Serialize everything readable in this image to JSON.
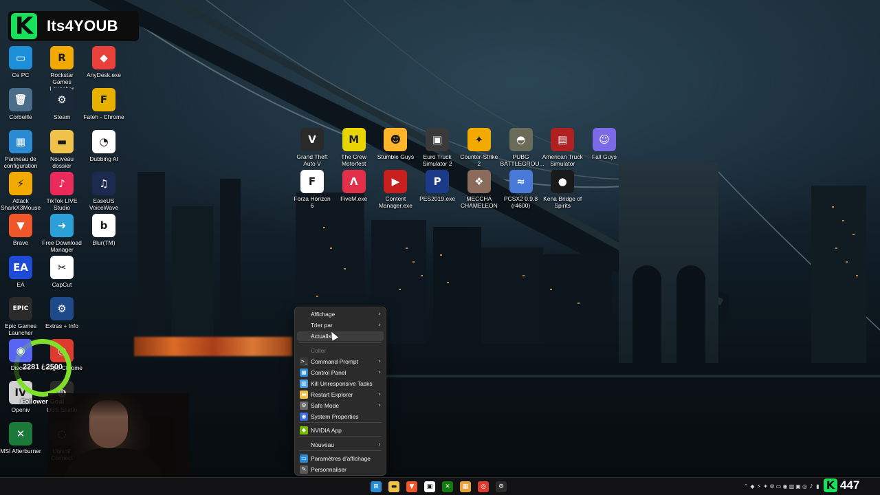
{
  "branding": {
    "logo_letter": "K",
    "channel_name": "Its4YOUB"
  },
  "desktop_icons_left": [
    {
      "label": "Ce PC",
      "glyph": "▭",
      "color": "#1d8fd8"
    },
    {
      "label": "Rockstar Games Launcher",
      "glyph": "R",
      "color": "#f2a900"
    },
    {
      "label": "AnyDesk.exe",
      "glyph": "◆",
      "color": "#e8403b"
    },
    {
      "label": "Corbeille",
      "glyph": "🗑",
      "color": "#4a6e8a"
    },
    {
      "label": "Steam",
      "glyph": "⚙",
      "color": "#1b2838"
    },
    {
      "label": "Fateh - Chrome",
      "glyph": "F",
      "color": "#e8b100"
    },
    {
      "label": "Panneau de configuration",
      "glyph": "▦",
      "color": "#2a8ad4"
    },
    {
      "label": "Nouveau dossier",
      "glyph": "▬",
      "color": "#f0c24a"
    },
    {
      "label": "Dubbing AI",
      "glyph": "◔",
      "color": "#ffffff"
    },
    {
      "label": "Attack SharkX3Mouse",
      "glyph": "⚡",
      "color": "#f2a900"
    },
    {
      "label": "TikTok LIVE Studio",
      "glyph": "♪",
      "color": "#ea2a5a"
    },
    {
      "label": "EaseUS VoiceWave",
      "glyph": "♫",
      "color": "#1b2a4e"
    },
    {
      "label": "Brave",
      "glyph": "▼",
      "color": "#f1562b"
    },
    {
      "label": "Free Download Manager",
      "glyph": "➜",
      "color": "#2a9fd8"
    },
    {
      "label": "Blur(TM)",
      "glyph": "b",
      "color": "#ffffff"
    },
    {
      "label": "EA",
      "glyph": "EA",
      "color": "#1e4ad8"
    },
    {
      "label": "CapCut",
      "glyph": "✂",
      "color": "#ffffff"
    },
    {
      "label": "Epic Games Launcher",
      "glyph": "EPIC",
      "color": "#2b2b2b"
    },
    {
      "label": "Extras + Info",
      "glyph": "⚙",
      "color": "#1f4a8a"
    },
    {
      "label": "Discord",
      "glyph": "◉",
      "color": "#5865f2"
    },
    {
      "label": "Google Chrome",
      "glyph": "◎",
      "color": "#dd3b2d"
    },
    {
      "label": "Openiv",
      "glyph": "IV",
      "color": "#cfcfcf"
    },
    {
      "label": "OBS Studio",
      "glyph": "◍",
      "color": "#2b2b2b"
    },
    {
      "label": "MSI Afterburner",
      "glyph": "✕",
      "color": "#1b7a3a"
    },
    {
      "label": "Ubisoft Connect",
      "glyph": "◌",
      "color": "#1b1b1b"
    }
  ],
  "desktop_icons_games": [
    {
      "label": "Grand Theft Auto V",
      "glyph": "V",
      "color": "#2a2a2a"
    },
    {
      "label": "The Crew Motorfest",
      "glyph": "M",
      "color": "#e8d400"
    },
    {
      "label": "Stumble Guys",
      "glyph": "☻",
      "color": "#ffb52a"
    },
    {
      "label": "Euro Truck Simulator 2",
      "glyph": "▣",
      "color": "#3a3a3a"
    },
    {
      "label": "Counter-Strike 2",
      "glyph": "✦",
      "color": "#f2a900"
    },
    {
      "label": "PUBG BATTLEGROU...",
      "glyph": "◓",
      "color": "#6b6b5a"
    },
    {
      "label": "American Truck Simulator",
      "glyph": "▤",
      "color": "#b02020"
    },
    {
      "label": "Fall Guys",
      "glyph": "☺",
      "color": "#7a6ae8"
    },
    {
      "label": "Forza Horizon 6",
      "glyph": "F",
      "color": "#ffffff"
    },
    {
      "label": "FiveM.exe",
      "glyph": "Λ",
      "color": "#e3304a"
    },
    {
      "label": "Content Manager.exe",
      "glyph": "▶",
      "color": "#c81f1f"
    },
    {
      "label": "PES2019.exe",
      "glyph": "P",
      "color": "#1b3a8a"
    },
    {
      "label": "MECCHA CHAMELEON",
      "glyph": "❖",
      "color": "#8a6a5a"
    },
    {
      "label": "PCSX2 0.9.8 (r4600)",
      "glyph": "≈",
      "color": "#4a7ad8"
    },
    {
      "label": "Kena Bridge of Spirits",
      "glyph": "●",
      "color": "#1a1a1a"
    }
  ],
  "context_menu": {
    "items": [
      {
        "label": "Affichage",
        "icon": "",
        "chevron": true
      },
      {
        "label": "Trier par",
        "icon": "",
        "chevron": true
      },
      {
        "label": "Actualiser",
        "icon": "",
        "chevron": false
      },
      {
        "label": "Coller",
        "icon": "",
        "chevron": false,
        "disabled": true
      },
      {
        "label": "Command Prompt",
        "icon": ">_",
        "icon_color": "#3a3a3a",
        "chevron": true
      },
      {
        "label": "Control Panel",
        "icon": "▦",
        "icon_color": "#2a8ad4",
        "chevron": true
      },
      {
        "label": "Kill Unresponsive Tasks",
        "icon": "▥",
        "icon_color": "#4aa0e8",
        "chevron": false
      },
      {
        "label": "Restart Explorer",
        "icon": "▬",
        "icon_color": "#f0c24a",
        "chevron": true
      },
      {
        "label": "Safe Mode",
        "icon": "⚙",
        "icon_color": "#6a6a6a",
        "chevron": true
      },
      {
        "label": "System Properties",
        "icon": "◉",
        "icon_color": "#3a6ad8",
        "chevron": false
      },
      {
        "label": "NVIDIA App",
        "icon": "◆",
        "icon_color": "#76b900",
        "chevron": false
      },
      {
        "label": "Nouveau",
        "icon": "",
        "chevron": true
      },
      {
        "label": "Paramètres d'affichage",
        "icon": "▭",
        "icon_color": "#2a8ad4",
        "chevron": false
      },
      {
        "label": "Personnaliser",
        "icon": "✎",
        "icon_color": "#5a5a5a",
        "chevron": false
      }
    ],
    "chevron_glyph": "›"
  },
  "follower_goal": {
    "count": "2281 / 2500",
    "label": "Follower Goal",
    "progress": 0.9124
  },
  "viewer_badge": {
    "logo_letter": "K",
    "count": "447"
  },
  "taskbar": {
    "apps": [
      {
        "name": "start-icon",
        "glyph": "⊞",
        "color": "#2a8ad4"
      },
      {
        "name": "file-explorer-icon",
        "glyph": "▬",
        "color": "#f0c24a"
      },
      {
        "name": "brave-icon",
        "glyph": "▼",
        "color": "#f1562b"
      },
      {
        "name": "store-icon",
        "glyph": "▣",
        "color": "#ffffff"
      },
      {
        "name": "xbox-icon",
        "glyph": "✕",
        "color": "#107c10"
      },
      {
        "name": "photos-icon",
        "glyph": "▦",
        "color": "#e8a23a"
      },
      {
        "name": "chrome-icon",
        "glyph": "◎",
        "color": "#dd3b2d"
      },
      {
        "name": "steam-icon",
        "glyph": "⚙",
        "color": "#2b2b2b"
      }
    ],
    "tray": [
      "⌃",
      "◆",
      "⚡",
      "✦",
      "⚙",
      "▭",
      "◉",
      "▥",
      "▣",
      "◎",
      "♪",
      "▮"
    ]
  },
  "colors": {
    "accent_green": "#19e05a",
    "goal_ring": "#7ee02b",
    "menu_bg": "#2b2b2b"
  }
}
